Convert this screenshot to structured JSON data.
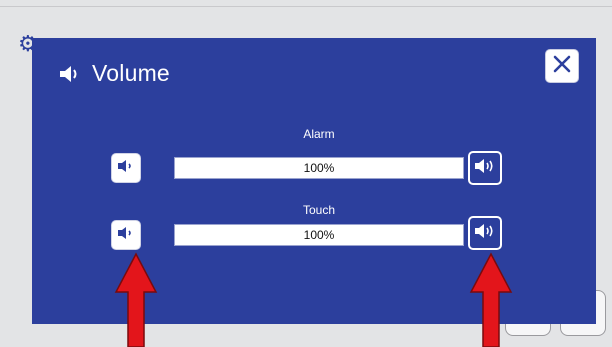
{
  "dialog": {
    "title": "Volume",
    "icons": {
      "title": "speaker-icon",
      "close": "close-icon"
    }
  },
  "sliders": [
    {
      "label": "Alarm",
      "value_text": "100%",
      "value": 1.0
    },
    {
      "label": "Touch",
      "value_text": "100%",
      "value": 1.0
    }
  ],
  "colors": {
    "dialog_bg": "#2c3f9d",
    "screen_bg": "#e3e4e6",
    "annotation_arrow": "#e3151b"
  }
}
